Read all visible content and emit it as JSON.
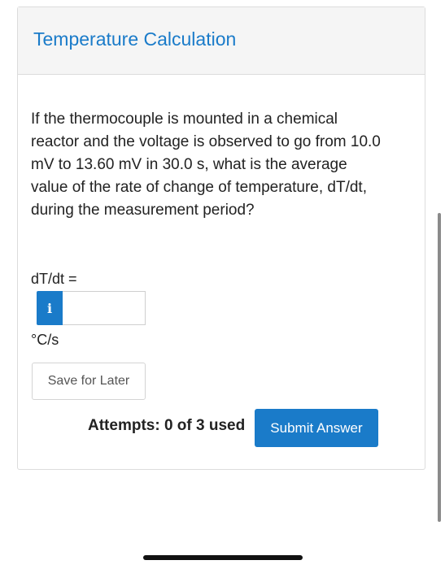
{
  "header": {
    "title": "Temperature Calculation"
  },
  "question": {
    "text": "If the thermocouple is mounted in a chemical reactor and the voltage is observed to go from 10.0 mV to 13.60 mV in 30.0 s, what is the average value of the rate of change of temperature, dT/dt, during the measurement period?"
  },
  "answer": {
    "label": "dT/dt =",
    "info_icon": "i",
    "value": "",
    "placeholder": "",
    "unit": "°C/s"
  },
  "actions": {
    "save_label": "Save for Later",
    "attempts_text": "Attempts: 0 of 3 used",
    "submit_label": "Submit Answer"
  },
  "colors": {
    "accent": "#1a7bc9",
    "header_bg": "#f5f5f5"
  },
  "icons": {
    "info": "info-icon"
  }
}
